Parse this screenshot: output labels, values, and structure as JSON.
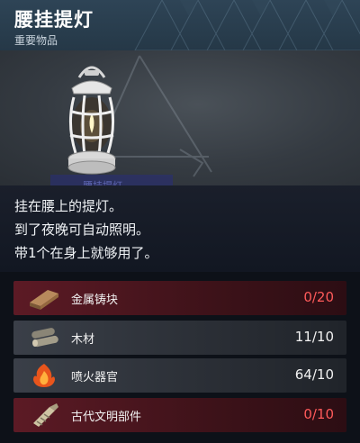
{
  "header": {
    "title": "腰挂提灯",
    "subtitle": "重要物品"
  },
  "preview": {
    "ghost_label": "腰挂提灯"
  },
  "description": {
    "lines": [
      "挂在腰上的提灯。",
      "到了夜晚可自动照明。",
      "带1个在身上就够用了。"
    ]
  },
  "materials": [
    {
      "name": "金属铸块",
      "count": "0/20",
      "status": "insufficient",
      "icon": "metal-ingot-icon"
    },
    {
      "name": "木材",
      "count": "11/10",
      "status": "sufficient",
      "icon": "wood-icon"
    },
    {
      "name": "喷火器官",
      "count": "64/10",
      "status": "sufficient",
      "icon": "flame-organ-icon"
    },
    {
      "name": "古代文明部件",
      "count": "0/10",
      "status": "insufficient",
      "icon": "ancient-part-icon"
    }
  ],
  "colors": {
    "insufficient_count": "#ff5a5a",
    "sufficient_count": "#f2f2f2",
    "insufficient_row": "#5c1a25",
    "sufficient_row": "#3a3f48"
  }
}
